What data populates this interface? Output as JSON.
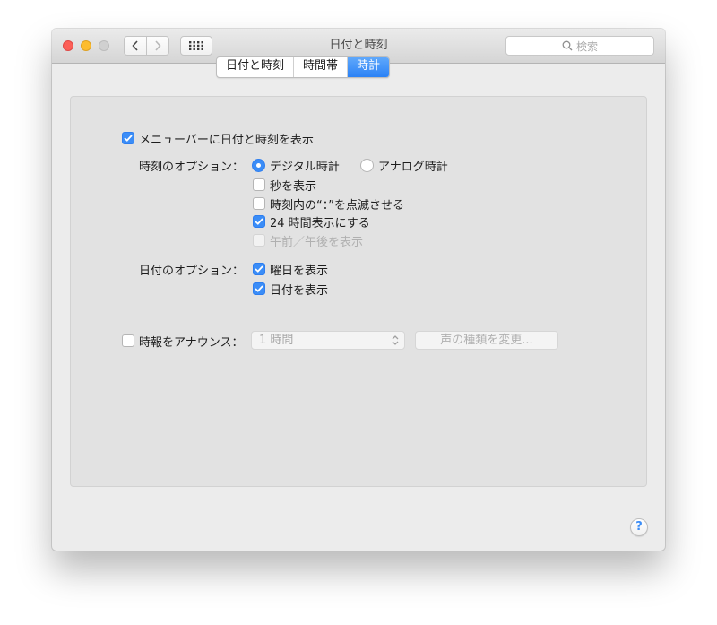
{
  "window": {
    "title": "日付と時刻"
  },
  "search": {
    "placeholder": "検索"
  },
  "tabs": [
    {
      "label": "日付と時刻",
      "active": false
    },
    {
      "label": "時間帯",
      "active": false
    },
    {
      "label": "時計",
      "active": true
    }
  ],
  "menubar": {
    "label": "メニューバーに日付と時刻を表示",
    "checked": true
  },
  "time_options": {
    "label": "時刻のオプション：",
    "digital_label": "デジタル時計",
    "analog_label": "アナログ時計",
    "selected": "digital",
    "seconds_label": "秒を表示",
    "seconds_checked": false,
    "blink_label": "時刻内の“：”を点滅させる",
    "blink_checked": false,
    "h24_label": "24 時間表示にする",
    "h24_checked": true,
    "ampm_label": "午前／午後を表示",
    "ampm_checked": false,
    "ampm_disabled": true
  },
  "date_options": {
    "label": "日付のオプション：",
    "weekday_label": "曜日を表示",
    "weekday_checked": true,
    "date_label": "日付を表示",
    "date_checked": true
  },
  "announce": {
    "label": "時報をアナウンス：",
    "checked": false,
    "interval_value": "1 時間",
    "voice_button_label": "声の種類を変更..."
  },
  "help": {
    "label": "?"
  },
  "colors": {
    "accent": "#3b8df7",
    "close": "#fc5f57",
    "minimize": "#fdbc2e"
  }
}
